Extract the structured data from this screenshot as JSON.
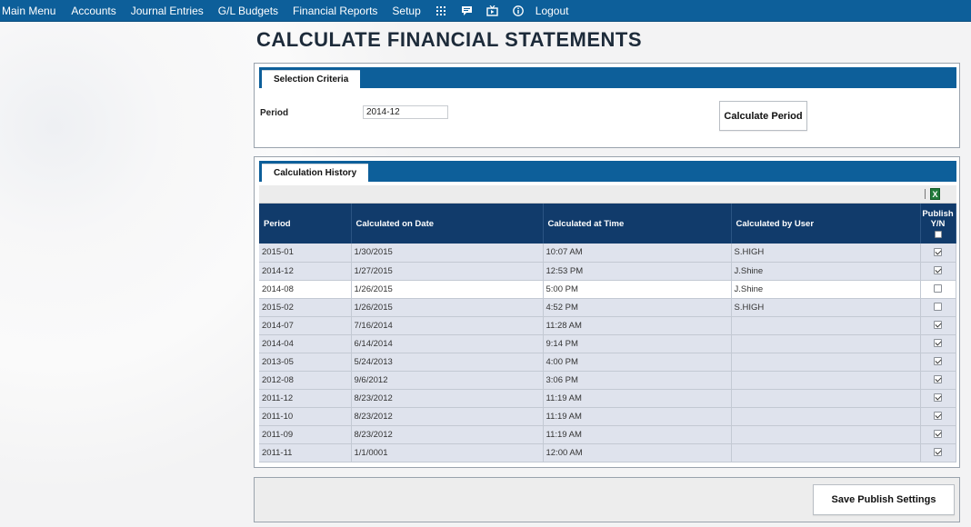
{
  "nav": {
    "main_menu": "Main Menu",
    "accounts": "Accounts",
    "journal_entries": "Journal Entries",
    "gl_budgets": "G/L Budgets",
    "financial_reports": "Financial Reports",
    "setup": "Setup",
    "logout": "Logout"
  },
  "page_title": "CALCULATE FINANCIAL STATEMENTS",
  "selection": {
    "tab_label": "Selection Criteria",
    "period_label": "Period",
    "period_value": "2014-12",
    "calculate_button": "Calculate Period"
  },
  "history": {
    "tab_label": "Calculation History",
    "export_icon": "X",
    "columns": {
      "period": "Period",
      "date": "Calculated on Date",
      "time": "Calculated at Time",
      "user": "Calculated by User",
      "publish": "Publish",
      "publish_yn": "Y/N"
    },
    "rows": [
      {
        "period": "2015-01",
        "date": "1/30/2015",
        "time": "10:07 AM",
        "user": "S.HIGH",
        "published": true
      },
      {
        "period": "2014-12",
        "date": "1/27/2015",
        "time": "12:53 PM",
        "user": "J.Shine",
        "published": true
      },
      {
        "period": "2014-08",
        "date": "1/26/2015",
        "time": "5:00 PM",
        "user": "J.Shine",
        "published": false
      },
      {
        "period": "2015-02",
        "date": "1/26/2015",
        "time": "4:52 PM",
        "user": "S.HIGH",
        "published": false
      },
      {
        "period": "2014-07",
        "date": "7/16/2014",
        "time": "11:28 AM",
        "user": "",
        "published": true
      },
      {
        "period": "2014-04",
        "date": "6/14/2014",
        "time": "9:14 PM",
        "user": "",
        "published": true
      },
      {
        "period": "2013-05",
        "date": "5/24/2013",
        "time": "4:00 PM",
        "user": "",
        "published": true
      },
      {
        "period": "2012-08",
        "date": "9/6/2012",
        "time": "3:06 PM",
        "user": "",
        "published": true
      },
      {
        "period": "2011-12",
        "date": "8/23/2012",
        "time": "11:19 AM",
        "user": "",
        "published": true
      },
      {
        "period": "2011-10",
        "date": "8/23/2012",
        "time": "11:19 AM",
        "user": "",
        "published": true
      },
      {
        "period": "2011-09",
        "date": "8/23/2012",
        "time": "11:19 AM",
        "user": "",
        "published": true
      },
      {
        "period": "2011-11",
        "date": "1/1/0001",
        "time": "12:00 AM",
        "user": "",
        "published": true
      }
    ]
  },
  "footer": {
    "save_button": "Save Publish Settings"
  },
  "colors": {
    "nav_bg": "#0d5f9a",
    "table_header_bg": "#113b6b",
    "row_bg": "#dfe3ed"
  }
}
